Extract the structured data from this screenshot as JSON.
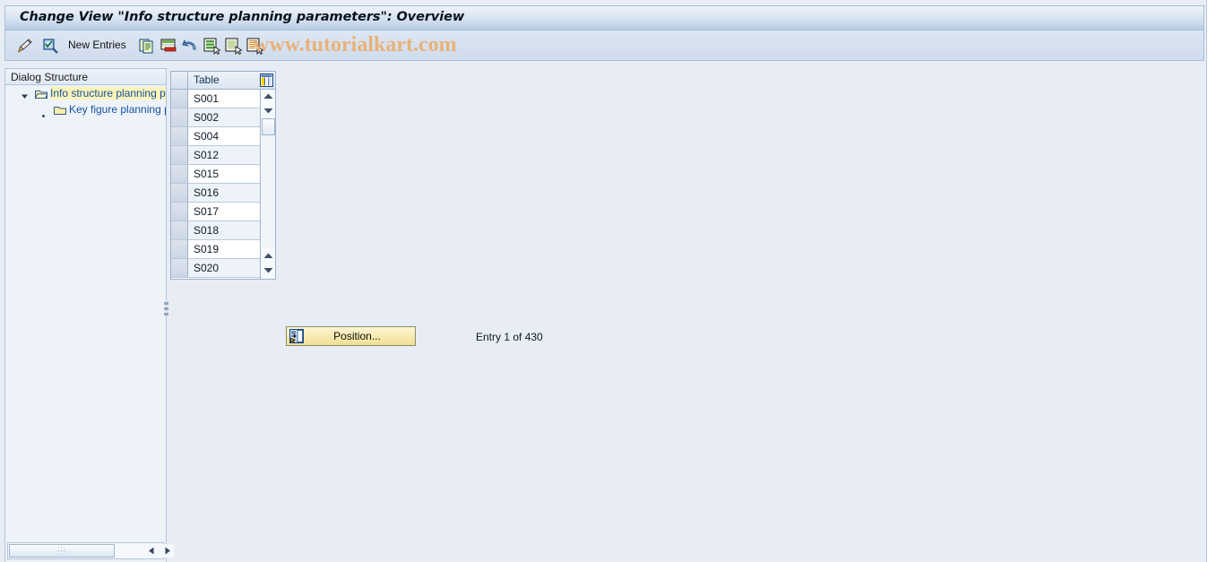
{
  "window": {
    "title": "Change View \"Info structure planning parameters\": Overview",
    "watermark": "www.tutorialkart.com"
  },
  "toolbar": {
    "new_entries_label": "New Entries",
    "icons": [
      {
        "name": "display-change-icon",
        "title": "Display/Change"
      },
      {
        "name": "check-magnifier-icon",
        "title": "Check"
      },
      {
        "name": "copy-as-icon",
        "title": "Copy As..."
      },
      {
        "name": "delete-icon",
        "title": "Delete"
      },
      {
        "name": "undo-icon",
        "title": "Undo Change"
      },
      {
        "name": "select-all-icon",
        "title": "Select All"
      },
      {
        "name": "deselect-all-icon",
        "title": "Deselect All"
      },
      {
        "name": "select-block-icon",
        "title": "Select Block"
      }
    ]
  },
  "tree": {
    "header": "Dialog Structure",
    "items": [
      {
        "label": "Info structure planning parameters",
        "icon": "open-folder-icon",
        "expanded": true,
        "selected": true,
        "level": 0
      },
      {
        "label": "Key figure planning parameters",
        "icon": "closed-folder-icon",
        "expanded": false,
        "selected": false,
        "level": 1
      }
    ],
    "hscroll": {
      "left_arrow": "scroll-left-icon",
      "right_arrow": "scroll-right-icon"
    }
  },
  "table": {
    "column_header": "Table",
    "config_icon": "column-config-icon",
    "rows": [
      {
        "table": "S001"
      },
      {
        "table": "S002"
      },
      {
        "table": "S004"
      },
      {
        "table": "S012"
      },
      {
        "table": "S015"
      },
      {
        "table": "S016"
      },
      {
        "table": "S017"
      },
      {
        "table": "S018"
      },
      {
        "table": "S019"
      },
      {
        "table": "S020"
      }
    ],
    "scroll": {
      "up_icon": "scroll-up-icon",
      "down_icon": "scroll-down-icon",
      "page_up_icon": "page-up-icon",
      "page_down_icon": "page-down-icon"
    }
  },
  "footer": {
    "position_button_label": "Position...",
    "position_button_icon": "position-icon",
    "entry_status": "Entry 1 of 430"
  },
  "colors": {
    "window_background": "#e8edf5",
    "title_gradient_top": "#eef3fa",
    "title_gradient_bottom": "#b9cce4",
    "tree_link": "#1452a0",
    "tree_selection": "#fbf3b9",
    "watermark": "#e8b279",
    "button_yellow": "#f6e9ae",
    "border": "#b6c6da"
  }
}
